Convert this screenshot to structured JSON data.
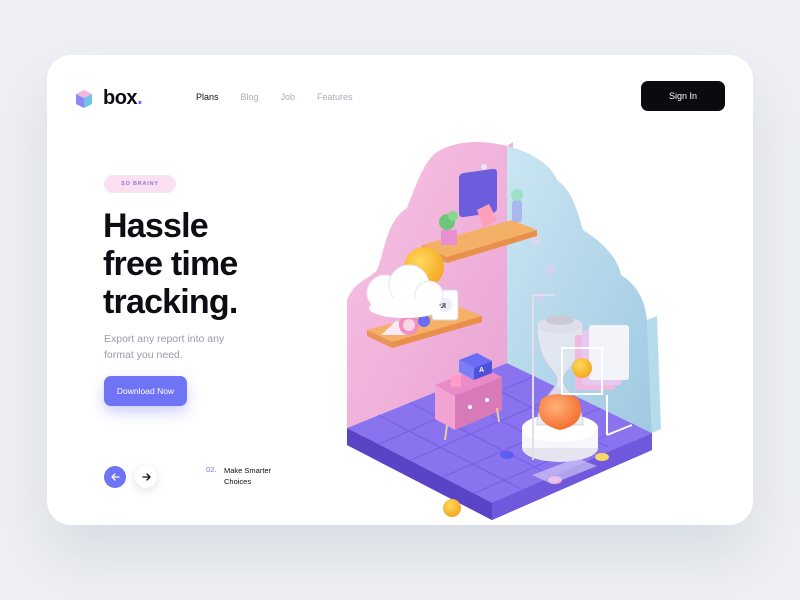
{
  "brand": {
    "name": "box",
    "dot": "."
  },
  "nav": [
    {
      "label": "Plans",
      "active": true
    },
    {
      "label": "Blog",
      "active": false
    },
    {
      "label": "Job",
      "active": false
    },
    {
      "label": "Features",
      "active": false
    }
  ],
  "header": {
    "signin_label": "Sign In"
  },
  "hero": {
    "tag": "SO BRAINY",
    "headline": [
      "Hassle",
      "free time",
      "tracking."
    ],
    "description": "Export any report into any format you need.",
    "cta_label": "Download Now"
  },
  "pager": {
    "prev_icon": "arrow-left-icon",
    "next_icon": "arrow-right-icon",
    "step_number": "02.",
    "step_text": "Make Smarter Choices"
  },
  "colors": {
    "accent": "#6e74f5",
    "dark": "#0b0b0f",
    "pink_wall": "#f5b6dd",
    "blue_wall": "#a9d6ec",
    "floor": "#7b64e3"
  },
  "illustration": {
    "screen_label": "UI",
    "box_letter": "A"
  }
}
